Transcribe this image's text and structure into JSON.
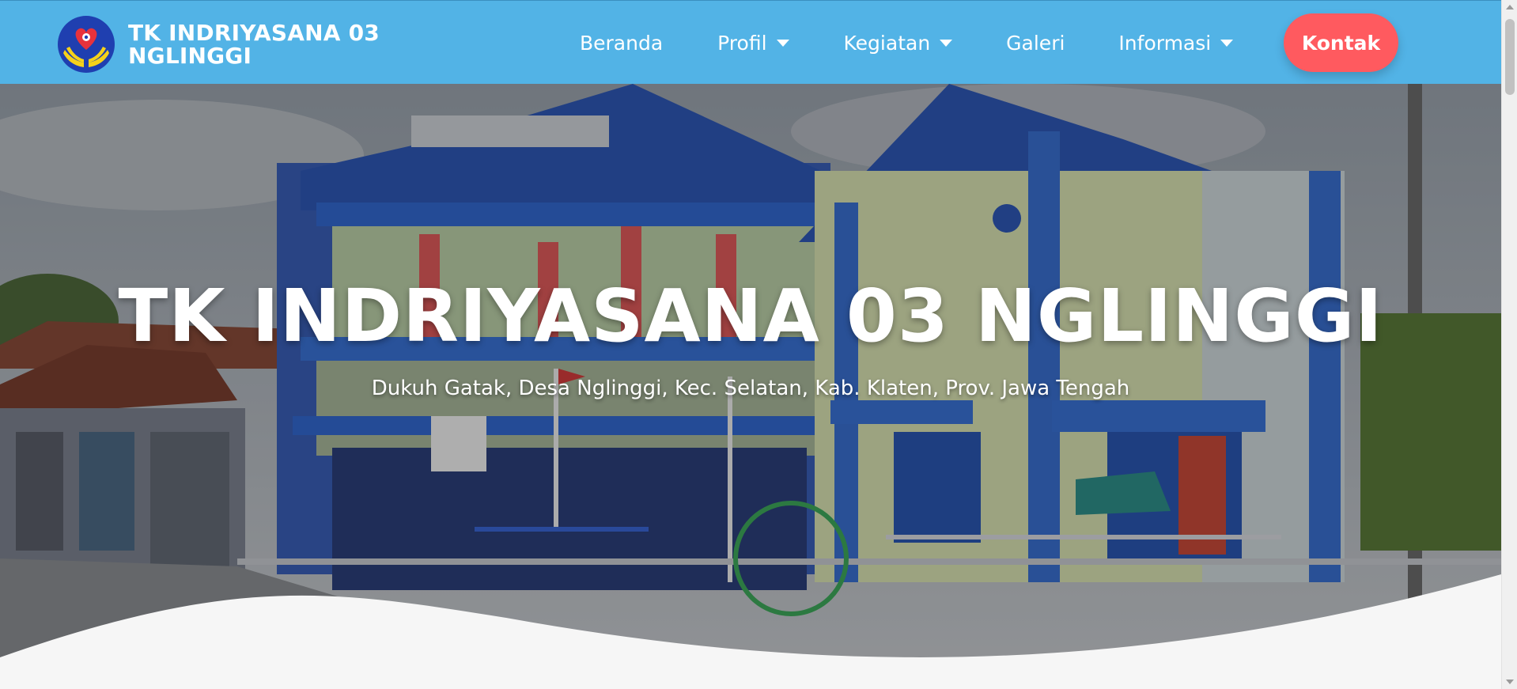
{
  "brand": {
    "name": "TK INDRIYASANA 03 NGLINGGI",
    "logo_icon": "heart-hands-logo-icon"
  },
  "nav": {
    "items": [
      {
        "label": "Beranda",
        "dropdown": false
      },
      {
        "label": "Profil",
        "dropdown": true
      },
      {
        "label": "Kegiatan",
        "dropdown": true
      },
      {
        "label": "Galeri",
        "dropdown": false
      },
      {
        "label": "Informasi",
        "dropdown": true
      }
    ],
    "cta_label": "Kontak"
  },
  "hero": {
    "title": "TK INDRIYASANA 03 NGLINGGI",
    "subtitle": "Dukuh Gatak, Desa Nglinggi, Kec. Selatan, Kab. Klaten, Prov. Jawa Tengah"
  },
  "colors": {
    "navbar": "#52b3e6",
    "cta": "#ff5a5f",
    "building_blue": "#3a6fd0",
    "wall_yellow": "#d8e2b2"
  }
}
